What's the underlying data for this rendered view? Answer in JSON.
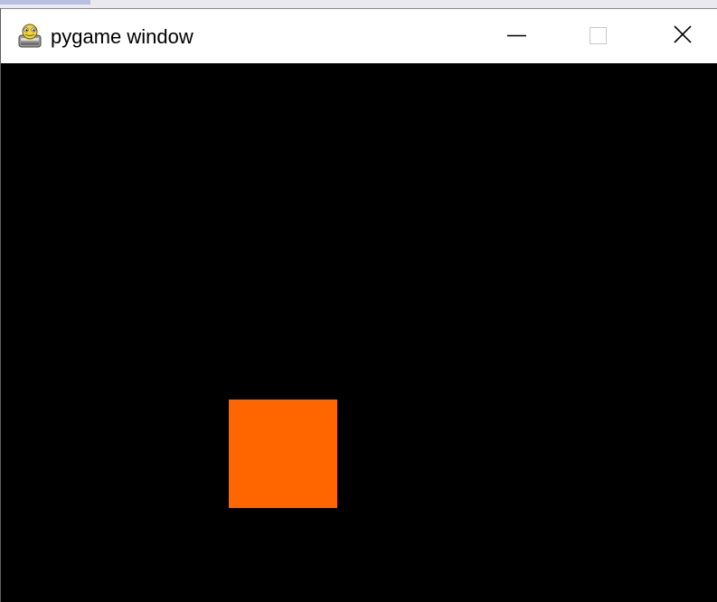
{
  "window": {
    "title": "pygame window",
    "app_icon": "pygame-snake-icon",
    "controls": [
      {
        "name": "minimize",
        "icon": "minimize-icon"
      },
      {
        "name": "maximize",
        "icon": "maximize-icon"
      },
      {
        "name": "close",
        "icon": "close-icon"
      }
    ]
  },
  "game": {
    "background_color": "#000000",
    "player": {
      "shape": "square",
      "color": "#ff6600"
    }
  }
}
